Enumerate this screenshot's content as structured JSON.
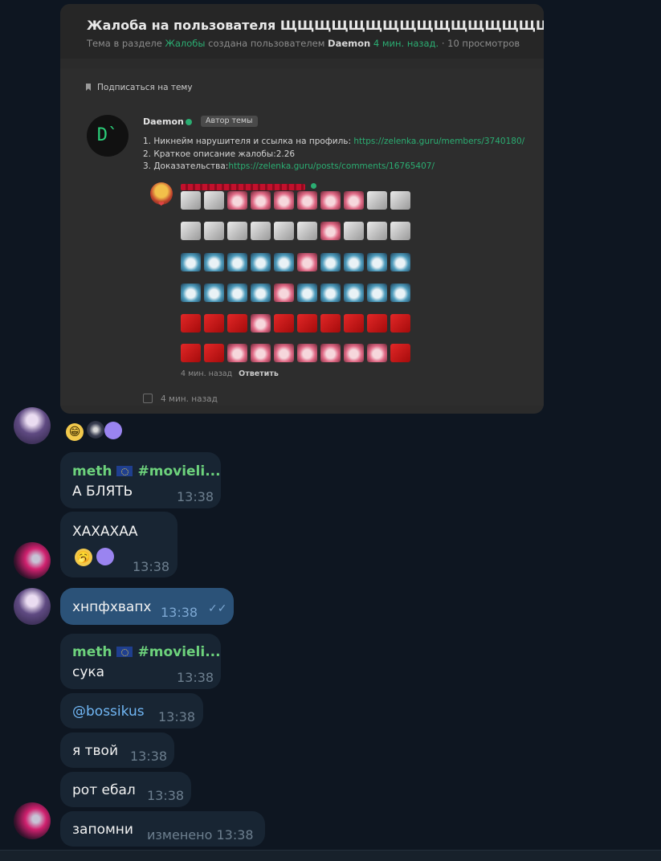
{
  "forum": {
    "title": "Жалоба на пользователя ЩЩЩЩЩЩЩЩЩЩЩЩЩЩЩЩЩЩЩ",
    "meta_prefix": "Тема в разделе",
    "meta_section": "Жалобы",
    "meta_mid": "создана пользователем",
    "meta_user": "Daemon",
    "meta_time": "4 мин. назад.",
    "meta_views": "· 10 просмотров",
    "subscribe": "Подписаться на тему",
    "avatar_letter": "D`",
    "author": "Daemon",
    "author_badge": "Автор темы",
    "line1_text": "1. Никнейм нарушителя и ссылка на профиль: ",
    "line1_link": "https://zelenka.guru/members/3740180/",
    "line2_text": "2. Краткое описание жалобы:2.26",
    "line3_text": "3. Доказательства:",
    "line3_link": "https://zelenka.guru/posts/comments/16765407/",
    "quote_time": "4 мин. назад",
    "quote_reply": "Ответить",
    "post_time": "4 мин. назад",
    "emote_rows": [
      [
        "w",
        "w",
        "p",
        "p",
        "p",
        "p",
        "p",
        "p",
        "w",
        "w"
      ],
      [
        "w",
        "w",
        "w",
        "w",
        "w",
        "w",
        "p",
        "w",
        "w",
        "w"
      ],
      [
        "b",
        "b",
        "b",
        "b",
        "b",
        "p",
        "b",
        "b",
        "b",
        "b"
      ],
      [
        "b",
        "b",
        "b",
        "b",
        "p",
        "b",
        "b",
        "b",
        "b",
        "b"
      ],
      [
        "r",
        "r",
        "r",
        "p",
        "r",
        "r",
        "r",
        "r",
        "r",
        "r"
      ],
      [
        "r",
        "r",
        "p",
        "p",
        "p",
        "p",
        "p",
        "p",
        "p",
        "r"
      ]
    ]
  },
  "chat": {
    "reaction1": "😁",
    "msg1": {
      "sender": "meth",
      "tag": "#movieli...",
      "text": "А БЛЯТЬ",
      "time": "13:38"
    },
    "msg2": {
      "text": "ХАХАХАА",
      "reaction": "🥱",
      "time": "13:38"
    },
    "msg3": {
      "text": "хнпфхвапх",
      "time": "13:38",
      "status": "read-checks-icon"
    },
    "msg4": {
      "sender": "meth",
      "tag": "#movieli...",
      "text": "сука",
      "time": "13:38"
    },
    "msg5": {
      "text": "@bossikus",
      "time": "13:38"
    },
    "msg6": {
      "text": "я твой",
      "time": "13:38"
    },
    "msg7": {
      "text": "рот ебал",
      "time": "13:38"
    },
    "msg8": {
      "text": "запомни",
      "time": "изменено 13:38"
    }
  },
  "colors": {
    "background": "#0e1621",
    "bubble_in": "#182533",
    "bubble_out": "#2b5278",
    "sender": "#6dd27c",
    "forum_link": "#2bad72"
  }
}
